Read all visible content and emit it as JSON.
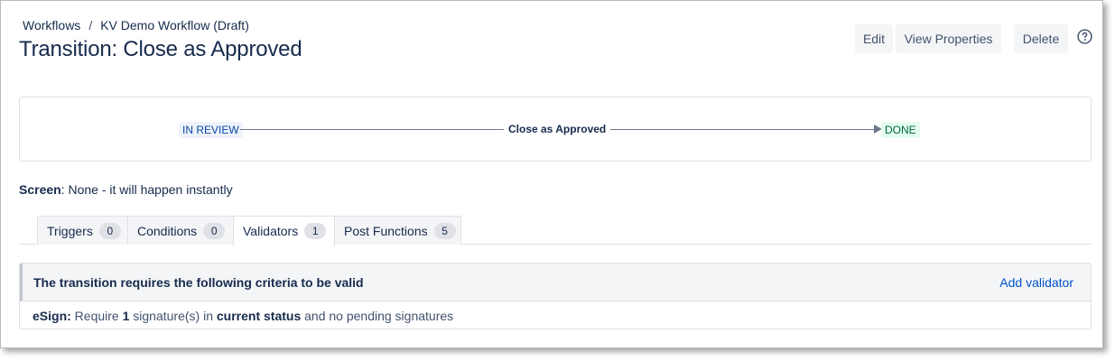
{
  "breadcrumb": {
    "items": [
      "Workflows",
      "KV Demo Workflow (Draft)"
    ],
    "separator": "/"
  },
  "page": {
    "title": "Transition: Close as Approved"
  },
  "header_actions": {
    "edit_label": "Edit",
    "view_properties_label": "View Properties",
    "delete_label": "Delete",
    "help_icon": "question-circle-icon"
  },
  "diagram": {
    "from_status": "IN REVIEW",
    "transition_name": "Close as Approved",
    "to_status": "DONE"
  },
  "screen_info": {
    "label": "Screen",
    "value": ": None - it will happen instantly"
  },
  "tabs": [
    {
      "label": "Triggers",
      "count": "0"
    },
    {
      "label": "Conditions",
      "count": "0"
    },
    {
      "label": "Validators",
      "count": "1"
    },
    {
      "label": "Post Functions",
      "count": "5"
    }
  ],
  "active_tab": "Validators",
  "validators_panel": {
    "title": "The transition requires the following criteria to be valid",
    "add_label": "Add validator",
    "rows": [
      {
        "name": "eSign:",
        "text_1": " Require ",
        "count": "1",
        "text_2": " signature(s) in ",
        "status": "current status",
        "text_3": " and no pending signatures"
      }
    ]
  },
  "colors": {
    "accent_link": "#0052cc",
    "status_review_bg": "#eef3fb",
    "status_review_fg": "#0747a6",
    "status_done_bg": "#e3fcef",
    "status_done_fg": "#006644"
  }
}
